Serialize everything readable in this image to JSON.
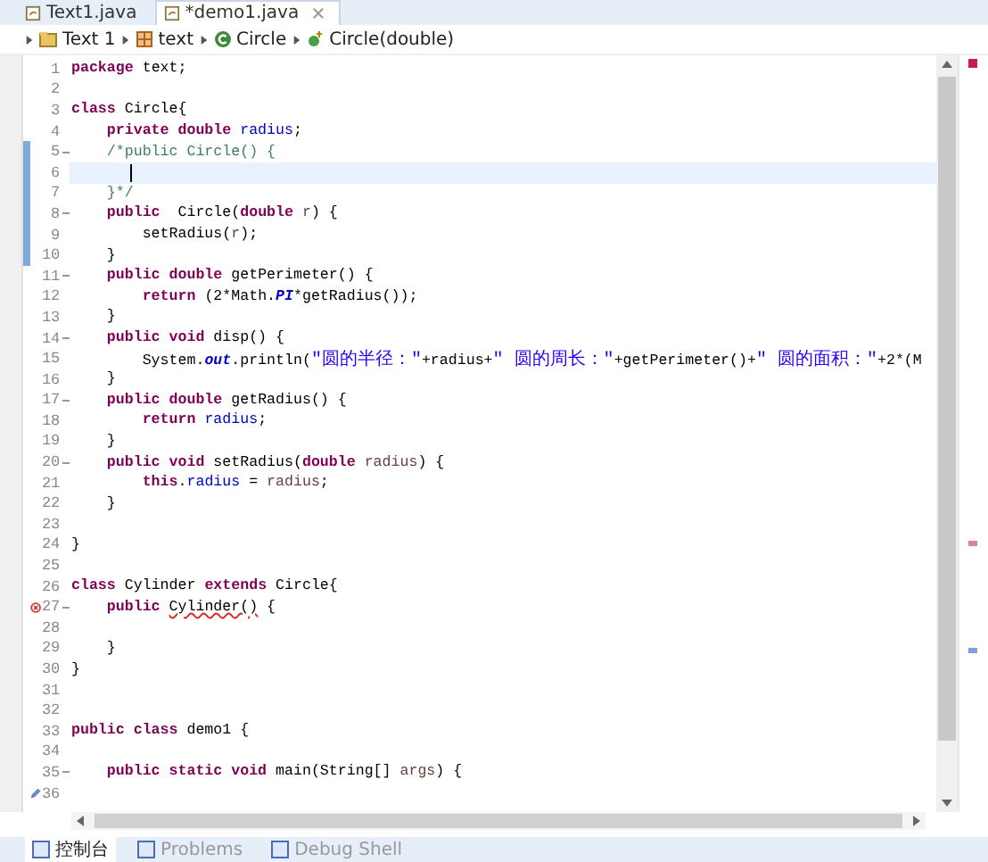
{
  "editor_tabs": [
    {
      "label": "Text1.java",
      "selected": false
    },
    {
      "label": "*demo1.java",
      "selected": true
    }
  ],
  "breadcrumb": [
    {
      "label": "Text 1",
      "kind": "project"
    },
    {
      "label": "text",
      "kind": "package"
    },
    {
      "label": "Circle",
      "kind": "class"
    },
    {
      "label": "Circle(double)",
      "kind": "method"
    }
  ],
  "lines": [
    {
      "number": "1",
      "tokens": [
        {
          "kind": "keyword",
          "text": "package"
        },
        {
          "kind": "plain",
          "text": " text;"
        }
      ]
    },
    {
      "number": "2"
    },
    {
      "number": "3",
      "tokens": [
        {
          "kind": "keyword",
          "text": "class"
        },
        {
          "kind": "plain",
          "text": " Circle{"
        }
      ]
    },
    {
      "number": "4",
      "tokens": [
        {
          "kind": "keyword",
          "text": "    private double"
        },
        {
          "kind": "field",
          "text": " radius"
        },
        {
          "kind": "plain",
          "text": ";"
        }
      ]
    },
    {
      "number": "5",
      "foldable": true,
      "changed": true,
      "tokens": [
        {
          "kind": "comment",
          "text": "    /*public Circle() {"
        }
      ]
    },
    {
      "number": "6",
      "changed": true,
      "current": true
    },
    {
      "number": "7",
      "changed": true,
      "tokens": [
        {
          "kind": "comment",
          "text": "    }*/"
        }
      ]
    },
    {
      "number": "8",
      "foldable": true,
      "changed": true,
      "tokens": [
        {
          "kind": "keyword",
          "text": "    public"
        },
        {
          "kind": "plain",
          "text": "  Circle("
        },
        {
          "kind": "keyword",
          "text": "double"
        },
        {
          "kind": "param",
          "text": " r"
        },
        {
          "kind": "plain",
          "text": ") {"
        }
      ]
    },
    {
      "number": "9",
      "changed": true,
      "tokens": [
        {
          "kind": "plain",
          "text": "        setRadius("
        },
        {
          "kind": "param",
          "text": "r"
        },
        {
          "kind": "plain",
          "text": ");"
        }
      ]
    },
    {
      "number": "10",
      "changed": true,
      "tokens": [
        {
          "kind": "plain",
          "text": "    }"
        }
      ]
    },
    {
      "number": "11",
      "foldable": true,
      "tokens": [
        {
          "kind": "keyword",
          "text": "    public double"
        },
        {
          "kind": "plain",
          "text": " getPerimeter() {"
        }
      ]
    },
    {
      "number": "12",
      "tokens": [
        {
          "kind": "keyword",
          "text": "        return"
        },
        {
          "kind": "plain",
          "text": " (2*Math."
        },
        {
          "kind": "static",
          "text": "PI"
        },
        {
          "kind": "plain",
          "text": "*getRadius());"
        }
      ]
    },
    {
      "number": "13",
      "tokens": [
        {
          "kind": "plain",
          "text": "    }"
        }
      ]
    },
    {
      "number": "14",
      "foldable": true,
      "tokens": [
        {
          "kind": "keyword",
          "text": "    public void"
        },
        {
          "kind": "plain",
          "text": " disp() {"
        }
      ]
    },
    {
      "number": "15",
      "tokens": [
        {
          "kind": "plain",
          "text": "        System."
        },
        {
          "kind": "static",
          "text": "out"
        },
        {
          "kind": "plain",
          "text": ".println("
        },
        {
          "kind": "string",
          "text": "\"圆的半径：\""
        },
        {
          "kind": "plain",
          "text": "+radius+"
        },
        {
          "kind": "string",
          "text": "\" 圆的周长：\""
        },
        {
          "kind": "plain",
          "text": "+getPerimeter()+"
        },
        {
          "kind": "string",
          "text": "\" 圆的面积：\""
        },
        {
          "kind": "plain",
          "text": "+2*(M"
        }
      ]
    },
    {
      "number": "16",
      "tokens": [
        {
          "kind": "plain",
          "text": "    }"
        }
      ]
    },
    {
      "number": "17",
      "foldable": true,
      "tokens": [
        {
          "kind": "keyword",
          "text": "    public double"
        },
        {
          "kind": "plain",
          "text": " getRadius() {"
        }
      ]
    },
    {
      "number": "18",
      "tokens": [
        {
          "kind": "keyword",
          "text": "        return"
        },
        {
          "kind": "field",
          "text": " radius"
        },
        {
          "kind": "plain",
          "text": ";"
        }
      ]
    },
    {
      "number": "19",
      "tokens": [
        {
          "kind": "plain",
          "text": "    }"
        }
      ]
    },
    {
      "number": "20",
      "foldable": true,
      "tokens": [
        {
          "kind": "keyword",
          "text": "    public void"
        },
        {
          "kind": "plain",
          "text": " setRadius("
        },
        {
          "kind": "keyword",
          "text": "double"
        },
        {
          "kind": "param",
          "text": " radius"
        },
        {
          "kind": "plain",
          "text": ") {"
        }
      ]
    },
    {
      "number": "21",
      "tokens": [
        {
          "kind": "keyword",
          "text": "        this"
        },
        {
          "kind": "plain",
          "text": "."
        },
        {
          "kind": "field",
          "text": "radius"
        },
        {
          "kind": "plain",
          "text": " = "
        },
        {
          "kind": "param",
          "text": "radius"
        },
        {
          "kind": "plain",
          "text": ";"
        }
      ]
    },
    {
      "number": "22",
      "tokens": [
        {
          "kind": "plain",
          "text": "    }"
        }
      ]
    },
    {
      "number": "23"
    },
    {
      "number": "24",
      "tokens": [
        {
          "kind": "plain",
          "text": "}"
        }
      ]
    },
    {
      "number": "25"
    },
    {
      "number": "26",
      "tokens": [
        {
          "kind": "keyword",
          "text": "class"
        },
        {
          "kind": "plain",
          "text": " Cylinder "
        },
        {
          "kind": "keyword",
          "text": "extends"
        },
        {
          "kind": "plain",
          "text": " Circle{"
        }
      ]
    },
    {
      "number": "27",
      "foldable": true,
      "error": true,
      "tokens": [
        {
          "kind": "keyword",
          "text": "    public "
        },
        {
          "kind": "error",
          "text": "Cylinder()"
        },
        {
          "kind": "plain",
          "text": " {"
        }
      ]
    },
    {
      "number": "28"
    },
    {
      "number": "29",
      "tokens": [
        {
          "kind": "plain",
          "text": "    }"
        }
      ]
    },
    {
      "number": "30",
      "tokens": [
        {
          "kind": "plain",
          "text": "}"
        }
      ]
    },
    {
      "number": "31"
    },
    {
      "number": "32"
    },
    {
      "number": "33",
      "tokens": [
        {
          "kind": "keyword",
          "text": "public class"
        },
        {
          "kind": "plain",
          "text": " demo1 {"
        }
      ]
    },
    {
      "number": "34"
    },
    {
      "number": "35",
      "foldable": true,
      "tokens": [
        {
          "kind": "keyword",
          "text": "    public static void"
        },
        {
          "kind": "plain",
          "text": " main(String[] "
        },
        {
          "kind": "param",
          "text": "args"
        },
        {
          "kind": "plain",
          "text": ") {"
        }
      ]
    },
    {
      "number": "36",
      "hint": true
    }
  ],
  "bottom_tabs": [
    {
      "label": "控制台",
      "selected": true
    },
    {
      "label": "Problems",
      "selected": false
    },
    {
      "label": "Debug Shell",
      "selected": false
    }
  ]
}
